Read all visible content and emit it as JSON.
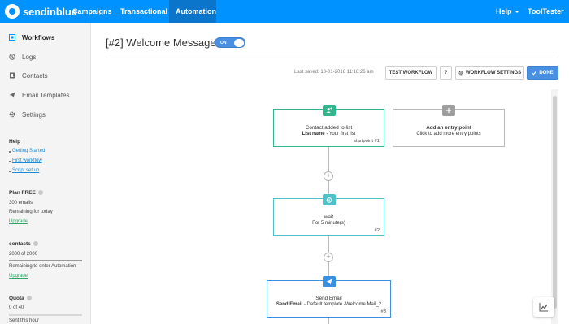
{
  "nav": {
    "brand": "sendinblue",
    "items": [
      {
        "label": "Campaigns"
      },
      {
        "label": "Transactional"
      },
      {
        "label": "Automation"
      }
    ],
    "help": "Help",
    "account": "ToolTester"
  },
  "sidebar": {
    "items": [
      {
        "label": "Workflows",
        "icon": "workflow-icon"
      },
      {
        "label": "Logs",
        "icon": "history-icon"
      },
      {
        "label": "Contacts",
        "icon": "contacts-book-icon"
      },
      {
        "label": "Email Templates",
        "icon": "paper-plane-icon"
      },
      {
        "label": "Settings",
        "icon": "gear-icon"
      }
    ],
    "help": {
      "title": "Help",
      "links": [
        "Getting Started",
        "First workflow",
        "Script set up"
      ]
    },
    "plan": {
      "title": "Plan FREE",
      "line1": "300 emails",
      "line2": "Remaining for today",
      "upgrade": "Upgrade"
    },
    "contacts": {
      "title": "contacts",
      "count": "2000 of 2000",
      "progress": 1.0,
      "note": "Remaining to enter Automation",
      "upgrade": "Upgrade"
    },
    "quota": {
      "title": "Quota",
      "count": "0 of 40",
      "progress": 0.0,
      "note": "Sent this hour"
    }
  },
  "workflow": {
    "title": "[#2] Welcome Message",
    "toggle": "ON",
    "last_saved": "Last saved: 10-01-2018 11:18:26 am",
    "buttons": {
      "test": "TEST WORKFLOW",
      "help": "?",
      "settings": "WORKFLOW SETTINGS",
      "done": "DONE"
    },
    "nodes": {
      "entry": {
        "line1": "Contact added to list",
        "line2_bold": "List name",
        "line2_rest": " - Your first list",
        "ref": "startpoint #1",
        "icon": "contact-add-icon"
      },
      "add_entry": {
        "line1": "Add an entry point",
        "line2": "Click to add more entry points",
        "icon": "plus-icon"
      },
      "wait": {
        "line1": "wait",
        "line2": "For 5 minute(s)",
        "ref": "#2",
        "icon": "clock-icon"
      },
      "email": {
        "line1": "Send Email",
        "line2_bold": "Send Email",
        "line2_rest": " - Default template -Welcome Mail_2",
        "ref": "#3",
        "icon": "send-icon"
      }
    },
    "plus": "+"
  },
  "colors": {
    "brand": "#0092ff",
    "nav_active": "#0b75cb",
    "green": "#35b58b",
    "teal": "#4fc2c8",
    "blue": "#3a8fe0",
    "gray": "#9e9e9e"
  }
}
